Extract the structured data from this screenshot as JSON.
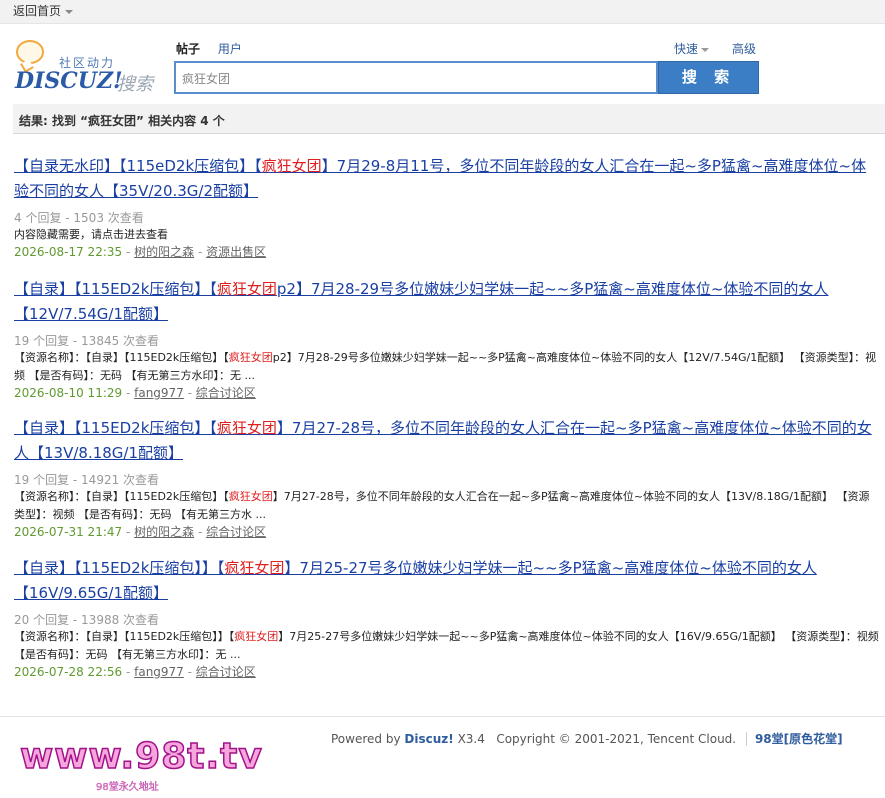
{
  "topbar": {
    "home": "返回首页"
  },
  "header": {
    "logo_slogan": "社区动力",
    "logo_brand": "DISCUZ!",
    "logo_search": "搜索",
    "tabs": [
      "帖子",
      "用户"
    ],
    "quick": "快速",
    "advanced": "高级",
    "search_value": "疯狂女团",
    "search_button": "搜 索"
  },
  "resultbar": "结果: 找到 “疯狂女团” 相关内容 4 个",
  "results": [
    {
      "title_pre": "【自录无水印】【115eD2k压缩包】【",
      "title_hl": "疯狂女团",
      "title_post": "】7月29-8月11号，多位不同年龄段的女人汇合在一起~多P猛禽~高难度体位~体验不同的女人【35V/20.3G/2配额】",
      "stats": "4 个回复 - 1503 次查看",
      "snippet_pre": "内容隐藏需要，请点击进去查看",
      "snippet_hl": "",
      "snippet_post": "",
      "date": "2026-08-17 22:35",
      "author": "树的阳之森",
      "forum": "资源出售区"
    },
    {
      "title_pre": "【自录】【115ED2k压缩包】【",
      "title_hl": "疯狂女团",
      "title_post": "p2】7月28-29号多位嫩妹少妇学妹一起~~多P猛禽~高难度体位~体验不同的女人【12V/7.54G/1配额】",
      "stats": "19 个回复 - 13845 次查看",
      "snippet_pre": "【资源名称】：【自录】【115ED2k压缩包】【",
      "snippet_hl": "疯狂女团",
      "snippet_post": "p2】7月28-29号多位嫩妹少妇学妹一起~~多P猛禽~高难度体位~体验不同的女人【12V/7.54G/1配额】 【资源类型】：视频 【是否有码】：无码 【有无第三方水印】：无 ...",
      "date": "2026-08-10 11:29",
      "author": "fang977",
      "forum": "综合讨论区"
    },
    {
      "title_pre": "【自录】【115ED2k压缩包】【",
      "title_hl": "疯狂女团",
      "title_post": "】7月27-28号，多位不同年龄段的女人汇合在一起~多P猛禽~高难度体位~体验不同的女人【13V/8.18G/1配额】",
      "stats": "19 个回复 - 14921 次查看",
      "snippet_pre": "【资源名称】：【自录】【115ED2k压缩包】【",
      "snippet_hl": "疯狂女团",
      "snippet_post": "】7月27-28号，多位不同年龄段的女人汇合在一起~多P猛禽~高难度体位~体验不同的女人【13V/8.18G/1配额】 【资源类型】：视频 【是否有码】：无码 【有无第三方水 ...",
      "date": "2026-07-31 21:47",
      "author": "树的阳之森",
      "forum": "综合讨论区"
    },
    {
      "title_pre": "【自录】【115ED2k压缩包】】【",
      "title_hl": "疯狂女团",
      "title_post": "】7月25-27号多位嫩妹少妇学妹一起~~多P猛禽~高难度体位~体验不同的女人【16V/9.65G/1配额】",
      "stats": "20 个回复 - 13988 次查看",
      "snippet_pre": "【资源名称】：【自录】【115ED2k压缩包】】【",
      "snippet_hl": "疯狂女团",
      "snippet_post": "】7月25-27号多位嫩妹少妇学妹一起~~多P猛禽~高难度体位~体验不同的女人【16V/9.65G/1配额】 【资源类型】：视频 【是否有码】：无码 【有无第三方水印】：无 ...",
      "date": "2026-07-28 22:56",
      "author": "fang977",
      "forum": "综合讨论区"
    }
  ],
  "meta_sep": " - ",
  "footer": {
    "powered": "Powered by",
    "brand": "Discuz!",
    "version": "X3.4",
    "copyright": "Copyright © 2001-2021, Tencent Cloud.",
    "sitename": "98堂[原色花堂]"
  },
  "watermark": {
    "big": "www.98t.tv",
    "small": "98堂永久地址"
  }
}
